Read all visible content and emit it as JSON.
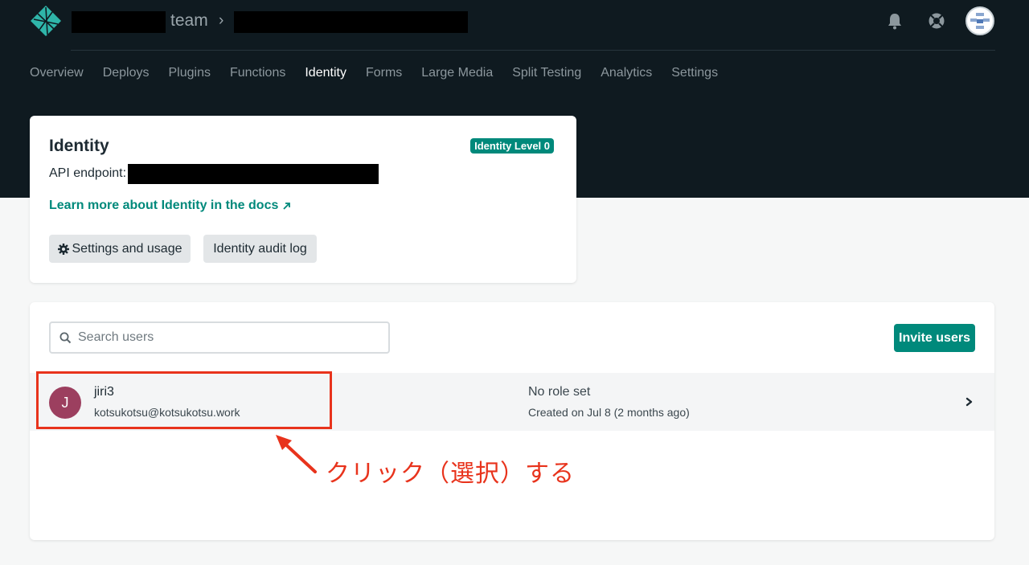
{
  "header": {
    "team_label": "team",
    "breadcrumb_separator": "›"
  },
  "nav": {
    "items": [
      {
        "label": "Overview"
      },
      {
        "label": "Deploys"
      },
      {
        "label": "Plugins"
      },
      {
        "label": "Functions"
      },
      {
        "label": "Identity",
        "active": true
      },
      {
        "label": "Forms"
      },
      {
        "label": "Large Media"
      },
      {
        "label": "Split Testing"
      },
      {
        "label": "Analytics"
      },
      {
        "label": "Settings"
      }
    ]
  },
  "identity_card": {
    "title": "Identity",
    "badge": "Identity Level 0",
    "endpoint_label": "API endpoint:",
    "docs_link": "Learn more about Identity in the docs",
    "settings_button": "Settings and usage",
    "audit_button": "Identity audit log"
  },
  "users": {
    "search_placeholder": "Search users",
    "invite_button": "Invite users",
    "rows": [
      {
        "initial": "J",
        "name": "jiri3",
        "email": "kotsukotsu@kotsukotsu.work",
        "role": "No role set",
        "created": "Created on Jul 8 (2 months ago)"
      }
    ]
  },
  "annotation": {
    "text": "クリック（選択）する"
  },
  "colors": {
    "header_bg": "#0f1a20",
    "accent": "#00897b",
    "annotation": "#e8331c",
    "user_avatar": "#9c3f5f"
  }
}
